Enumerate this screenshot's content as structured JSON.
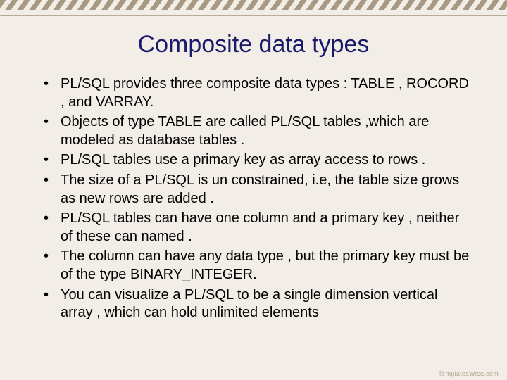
{
  "title": "Composite data types",
  "bullets": [
    "PL/SQL provides three composite data types : TABLE , ROCORD , and VARRAY.",
    "Objects of type TABLE are called PL/SQL tables ,which are modeled as database tables .",
    "PL/SQL tables use a primary key as array access to rows .",
    "The size of a PL/SQL is un constrained, i.e, the table size grows as new rows are added .",
    "PL/SQL tables can have one column and a primary key , neither of these can named .",
    "The column can have any data type , but the primary key must be of the type BINARY_INTEGER.",
    "You can visualize a PL/SQL to be a single dimension vertical array , which can hold unlimited elements"
  ],
  "watermark": "TemplatesWise.com"
}
